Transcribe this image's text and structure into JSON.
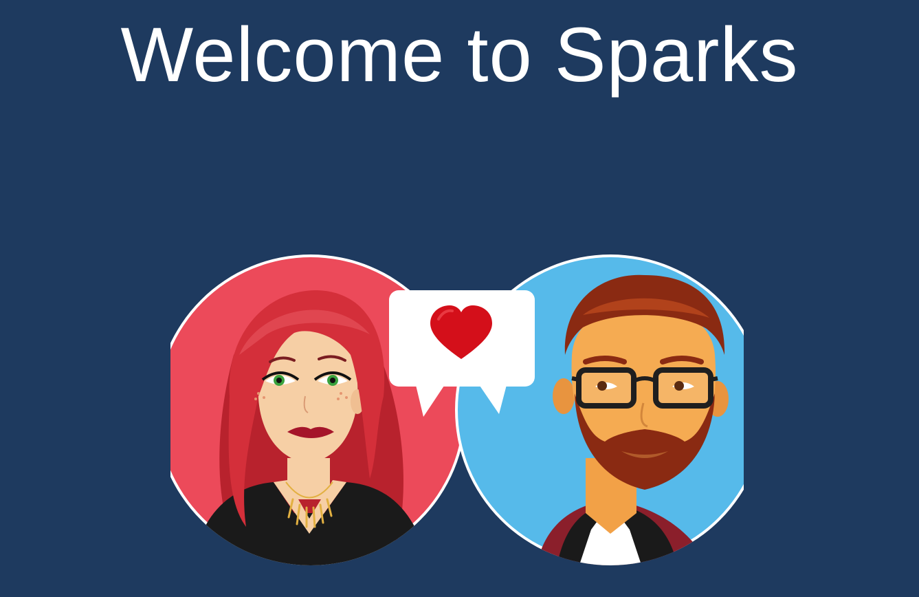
{
  "welcome": {
    "title": "Welcome to Sparks"
  },
  "illustration": {
    "icons": {
      "woman_avatar": "woman-avatar-icon",
      "man_avatar": "man-avatar-icon",
      "speech_bubble": "speech-bubble-icon",
      "heart": "heart-icon"
    },
    "colors": {
      "background": "#1e3a5f",
      "woman_circle": "#ec4a5a",
      "man_circle": "#56baea",
      "heart": "#d40f1a",
      "bubble": "#ffffff"
    }
  }
}
